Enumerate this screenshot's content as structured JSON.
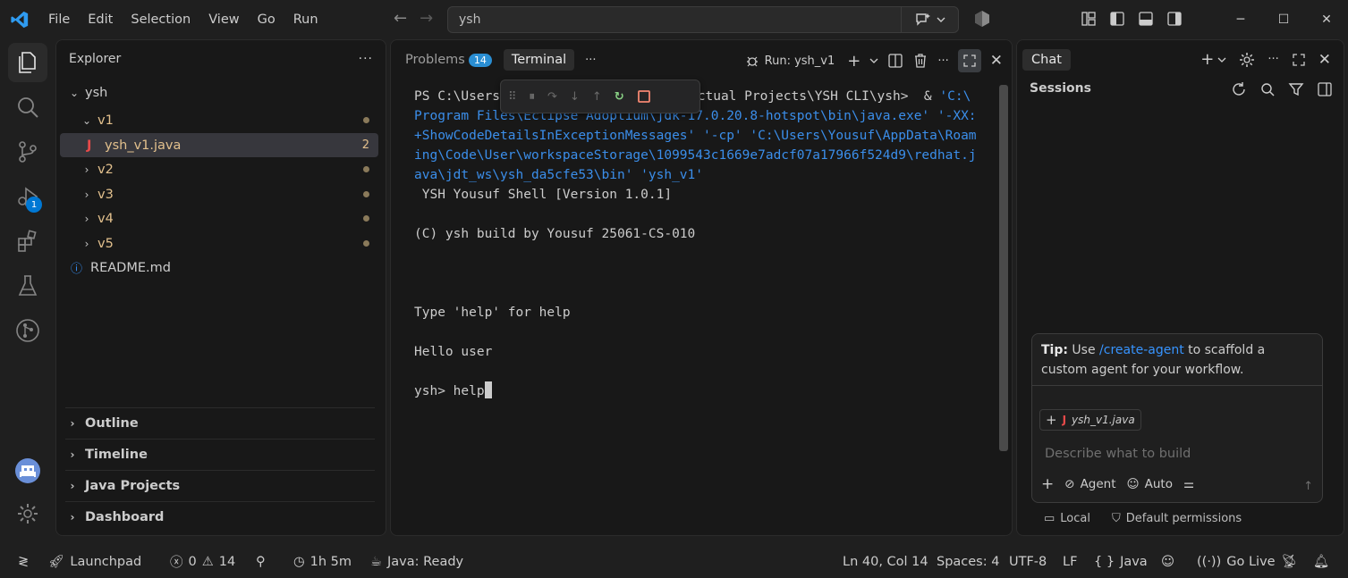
{
  "menu": [
    "File",
    "Edit",
    "Selection",
    "View",
    "Go",
    "Run"
  ],
  "search": {
    "value": "ysh"
  },
  "explorer": {
    "title": "Explorer",
    "root": "ysh",
    "items": [
      {
        "label": "v1",
        "kind": "folder-open"
      },
      {
        "label": "ysh_v1.java",
        "kind": "java",
        "badge": "2"
      },
      {
        "label": "v2",
        "kind": "folder"
      },
      {
        "label": "v3",
        "kind": "folder"
      },
      {
        "label": "v4",
        "kind": "folder"
      },
      {
        "label": "v5",
        "kind": "folder"
      },
      {
        "label": "README.md",
        "kind": "info"
      }
    ],
    "sections": [
      "Outline",
      "Timeline",
      "Java Projects",
      "Dashboard"
    ]
  },
  "activity": {
    "debug_badge": "1"
  },
  "panel": {
    "tabs": {
      "problems": "Problems",
      "problems_count": "14",
      "terminal": "Terminal"
    },
    "run_label": "Run: ysh_v1",
    "terminal": {
      "line1_a": "PS C:\\Users",
      "line1_b": "Actual Projects\\YSH CLI\\ysh>  & ",
      "line1_c": "'C:\\",
      "line2": "Program Files\\Eclipse Adoptium\\jdk-17.0.20.8-hotspot\\bin\\java.exe' '-XX:",
      "line3": "+ShowCodeDetailsInExceptionMessages' '-cp' 'C:\\Users\\Yousuf\\AppData\\Roam",
      "line4": "ing\\Code\\User\\workspaceStorage\\1099543c1669e7adcf07a17966f524d9\\redhat.j",
      "line5": "ava\\jdt_ws\\ysh_da5cfe53\\bin' 'ysh_v1'",
      "line6": " YSH Yousuf Shell [Version 1.0.1]",
      "line7": "(C) ysh build by Yousuf 25061-CS-010",
      "line8": "Type 'help' for help",
      "line9": "Hello user",
      "line10": "ysh> help"
    }
  },
  "chat": {
    "tab": "Chat",
    "sessions": "Sessions",
    "tip_bold": "Tip:",
    "tip_pre": " Use ",
    "tip_link": "/create-agent",
    "tip_post": " to scaffold a custom agent for your workflow.",
    "attachment": "ysh_v1.java",
    "placeholder": "Describe what to build",
    "mode": "Agent",
    "model": "Auto",
    "footer_local": "Local",
    "footer_perms": "Default permissions"
  },
  "status": {
    "launchpad": "Launchpad",
    "errors": "0",
    "warnings": "14",
    "time": "1h 5m",
    "java": "Java: Ready",
    "position": "Ln 40, Col 14",
    "spaces": "Spaces: 4",
    "encoding": "UTF-8",
    "eol": "LF",
    "language": "Java",
    "golive": "Go Live"
  },
  "colors": {
    "accent": "#0078d4",
    "java_icon": "#e84a4a",
    "folder_mod": "#e2c08d",
    "link": "#3794ff",
    "terminal_blue": "#3b8eea"
  }
}
